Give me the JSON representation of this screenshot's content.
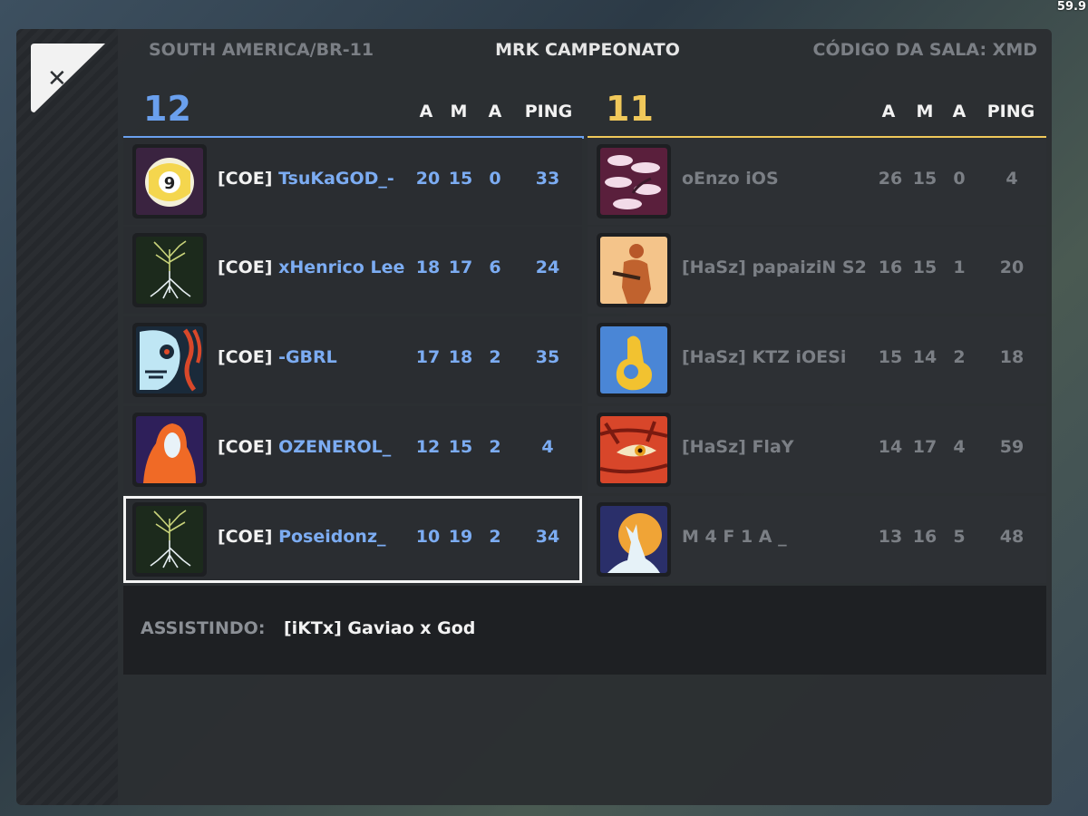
{
  "fps": "59.9",
  "header": {
    "region": "SOUTH AMERICA/BR-11",
    "title": "MRK CAMPEONATO",
    "room_code": "CÓDIGO DA SALA: XMD"
  },
  "columns": {
    "a1": "A",
    "m": "M",
    "a2": "A",
    "ping": "PING"
  },
  "team_blue": {
    "score": "12",
    "color": "#6aa0ee",
    "players": [
      {
        "tag": "[COE]",
        "nick": "TsuKaGOD_-",
        "a": "20",
        "m": "15",
        "as": "0",
        "ping": "33",
        "avatar": "billiard-ball-9"
      },
      {
        "tag": "[COE]",
        "nick": "xHenrico Lee",
        "a": "18",
        "m": "17",
        "as": "6",
        "ping": "24",
        "avatar": "tree-roots"
      },
      {
        "tag": "[COE]",
        "nick": "-GBRL",
        "a": "17",
        "m": "18",
        "as": "2",
        "ping": "35",
        "avatar": "skull"
      },
      {
        "tag": "[COE]",
        "nick": "OZENEROL_",
        "a": "12",
        "m": "15",
        "as": "2",
        "ping": "4",
        "avatar": "hooded-figure"
      },
      {
        "tag": "[COE]",
        "nick": "Poseidonz_",
        "a": "10",
        "m": "19",
        "as": "2",
        "ping": "34",
        "avatar": "tree-roots"
      }
    ]
  },
  "team_gold": {
    "score": "11",
    "color": "#f0c85a",
    "players": [
      {
        "name": "oEnzo iOS",
        "a": "26",
        "m": "15",
        "as": "0",
        "ping": "4",
        "avatar": "cherry-clouds"
      },
      {
        "name": "[HaSz] papaiziN S2",
        "a": "16",
        "m": "15",
        "as": "1",
        "ping": "20",
        "avatar": "soldier"
      },
      {
        "name": "[HaSz] KTZ iOESi",
        "a": "15",
        "m": "14",
        "as": "2",
        "ping": "18",
        "avatar": "ok-hand"
      },
      {
        "name": "[HaSz] FlaY",
        "a": "14",
        "m": "17",
        "as": "4",
        "ping": "59",
        "avatar": "tiger-eye"
      },
      {
        "name": "M 4 F 1 A _",
        "a": "13",
        "m": "16",
        "as": "5",
        "ping": "48",
        "avatar": "howling-wolf"
      }
    ]
  },
  "spectating": {
    "label": "ASSISTINDO:",
    "name": "[iKTx] Gaviao x God"
  }
}
